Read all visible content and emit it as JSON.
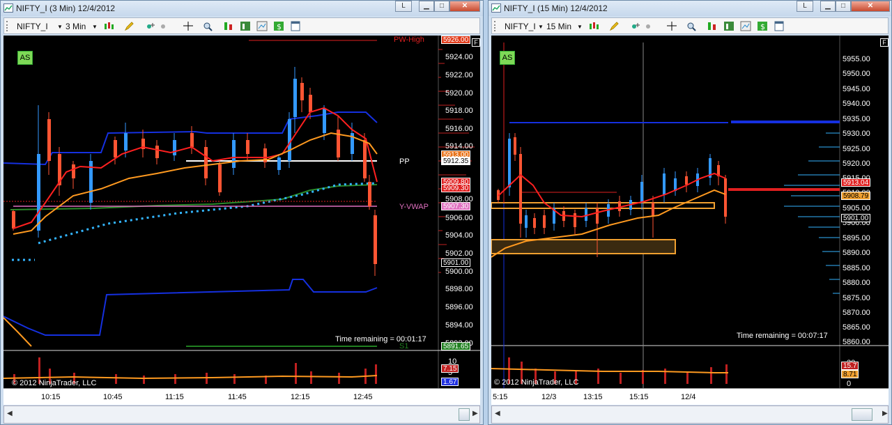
{
  "windows": [
    {
      "title": "NIFTY_I (3 Min)  12/4/2012",
      "instrument": "NIFTY_I",
      "interval": "3 Min",
      "as_label": "AS",
      "f_label": "F",
      "time_remaining": "Time remaining = 00:01:17",
      "copyright": "© 2012 NinjaTrader, LLC",
      "price_axis": [
        "5924.00",
        "5922.00",
        "5920.00",
        "5918.00",
        "5916.00",
        "5914.00",
        "5908.00",
        "5906.00",
        "5904.00",
        "5902.00",
        "5900.00",
        "5898.00",
        "5896.00",
        "5894.00",
        "5892.00"
      ],
      "price_tags": [
        {
          "text": "5926.00",
          "bg": "#e03a1a",
          "fg": "#ffffff"
        },
        {
          "text": "5913.00",
          "bg": "#e8731a",
          "fg": "#ffffff"
        },
        {
          "text": "5912.35",
          "bg": "#ffffff",
          "fg": "#000000"
        },
        {
          "text": "5909.80",
          "bg": "#e02020",
          "fg": "#ffffff"
        },
        {
          "text": "5909.30",
          "bg": "#e02020",
          "fg": "#ffffff"
        },
        {
          "text": "5907.30",
          "bg": "#e070c0",
          "fg": "#ffffff"
        },
        {
          "text": "5901.00",
          "bg": "#000000",
          "fg": "#ffffff"
        },
        {
          "text": "5891.65",
          "bg": "#208020",
          "fg": "#ffffff"
        }
      ],
      "line_labels": {
        "pw_high": "PW-High",
        "pp": "PP",
        "y_vwap": "Y-VWAP",
        "s1": "S1"
      },
      "volume_axis": [
        "10",
        "5"
      ],
      "volume_tags": [
        {
          "text": "7.15",
          "bg": "#c02020"
        },
        {
          "text": "1.67",
          "bg": "#2030e0"
        }
      ],
      "time_axis": [
        "10:15",
        "10:45",
        "11:15",
        "11:45",
        "12:15",
        "12:45"
      ]
    },
    {
      "title": "NIFTY_I (15 Min)  12/4/2012",
      "instrument": "NIFTY_I",
      "interval": "15 Min",
      "as_label": "AS",
      "f_label": "F",
      "time_remaining": "Time remaining = 00:07:17",
      "copyright": "© 2012 NinjaTrader, LLC",
      "price_axis": [
        "5955.00",
        "5950.00",
        "5945.00",
        "5940.00",
        "5935.00",
        "5930.00",
        "5925.00",
        "5920.00",
        "5915.00",
        "5910.00",
        "5905.00",
        "5900.00",
        "5895.00",
        "5890.00",
        "5885.00",
        "5880.00",
        "5875.00",
        "5870.00",
        "5865.00",
        "5860.00"
      ],
      "price_tags": [
        {
          "text": "5913.04",
          "bg": "#e02020",
          "fg": "#ffffff"
        },
        {
          "text": "5908.79",
          "bg": "#f0a030",
          "fg": "#000000"
        },
        {
          "text": "5901.00",
          "bg": "#000000",
          "fg": "#ffffff"
        }
      ],
      "volume_axis": [
        "20",
        "0"
      ],
      "volume_tags": [
        {
          "text": "15.7",
          "bg": "#c02020"
        },
        {
          "text": "8.71",
          "bg": "#f0a030"
        }
      ],
      "time_axis": [
        "5:15",
        "12/3",
        "13:15",
        "15:15",
        "12/4"
      ]
    }
  ],
  "colors": {
    "background": "#000000",
    "candle_up": "#3399ff",
    "candle_down": "#ff5533",
    "sma_red": "#ff2020",
    "sma_orange": "#ff9a20",
    "channel": "#0000ff",
    "vwap_dots": "#33b5ff",
    "pp_line": "#ffffff",
    "ma_green": "#2a8a2a"
  },
  "icons": [
    "chart-icon",
    "candlestick-icon",
    "pencil-icon",
    "add-indicator-icon",
    "crosshair-icon",
    "zoom-icon",
    "strategy-icon",
    "bars-icon",
    "properties-icon",
    "dollar-icon",
    "data-box-icon"
  ]
}
